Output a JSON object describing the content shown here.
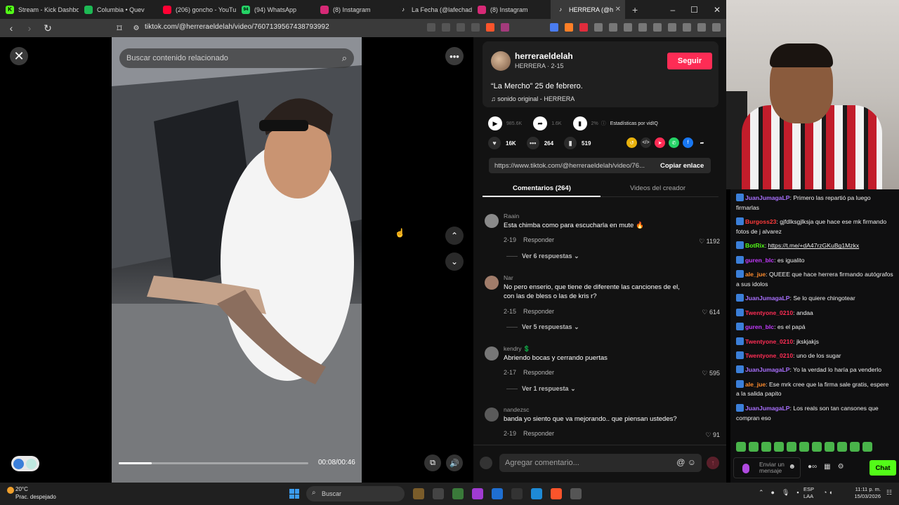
{
  "browser": {
    "tabs": [
      {
        "title": "Stream - Kick Dashbo",
        "fav_color": "#53fc18",
        "fav_char": "K"
      },
      {
        "title": "Columbia • Quev",
        "fav_color": "#1db954",
        "fav_char": ""
      },
      {
        "title": "(206) goncho - YouTu",
        "fav_color": "#ff0033",
        "fav_char": ""
      },
      {
        "title": "(94) WhatsApp",
        "fav_color": "#25d366",
        "fav_char": "94"
      },
      {
        "title": "(8) Instagram",
        "fav_color": "#d62976",
        "fav_char": ""
      },
      {
        "title": "La Fecha (@lafechade",
        "fav_color": "#ffffff",
        "fav_char": "♪"
      },
      {
        "title": "(8) Instagram",
        "fav_color": "#d62976",
        "fav_char": ""
      },
      {
        "title": "HERRERA (@h",
        "fav_color": "#ffffff",
        "fav_char": "♪",
        "active": true
      }
    ],
    "url": "tiktok.com/@herreraeldelah/video/7607139567438793992"
  },
  "video": {
    "search_placeholder": "Buscar contenido relacionado",
    "progress": 0.174,
    "time": "00:08/00:46"
  },
  "creator": {
    "handle": "herreraeldelah",
    "subtitle": "HERRERA · 2-15",
    "follow_label": "Seguir",
    "description": "“La Mercho” 25 de febrero.",
    "sound": "sonido original - HERRERA"
  },
  "stats": {
    "plays": "985.6K",
    "shares": "1.6K",
    "percent": "2%",
    "stats_label": "Estadísticas por vidIQ"
  },
  "actions": {
    "likes": "16K",
    "comments": "264",
    "saves": "519"
  },
  "link": {
    "url": "https://www.tiktok.com/@herreraeldelah/video/76...",
    "copy_label": "Copiar enlace"
  },
  "tabs": {
    "comments": "Comentarios (264)",
    "creator_videos": "Videos del creador"
  },
  "comments": [
    {
      "user": "Raain",
      "text": "Esta chimba como para escucharla en mute 🔥",
      "date": "2-19",
      "reply": "Responder",
      "likes": "1192",
      "more": "Ver 6 respuestas"
    },
    {
      "user": "Nar",
      "text": "No pero enserio, que tiene de diferente las canciones de el, con las de bless o las de kris r?",
      "date": "2-15",
      "reply": "Responder",
      "likes": "614",
      "more": "Ver 5 respuestas"
    },
    {
      "user": "kendry 💲",
      "text": "Abriendo bocas y cerrando puertas",
      "date": "2-17",
      "reply": "Responder",
      "likes": "595",
      "more": "Ver 1 respuesta"
    },
    {
      "user": "nandezsc",
      "text": "banda yo siento que va mejorando.. que piensan ustedes?",
      "date": "2-19",
      "reply": "Responder",
      "likes": "91",
      "more": ""
    }
  ],
  "comment_input": {
    "placeholder": "Agregar comentario..."
  },
  "chat": {
    "messages": [
      {
        "user": "JuanJumagaLP",
        "color": "#a970ff",
        "text": "Primero las repartió pa luego firmarlas"
      },
      {
        "user": "Burgoss23",
        "color": "#ff3b3b",
        "text": "gjfdlksgjlksja que hace ese mk firmando fotos de j alvarez"
      },
      {
        "user": "BotRix",
        "color": "#53fc18",
        "text": "https://t.me/+dA47rzGKuBg1Mzkx"
      },
      {
        "user": "guren_blc",
        "color": "#c43bff",
        "text": "es igualito"
      },
      {
        "user": "ale_jue",
        "color": "#ff8c2e",
        "text": "QUEEE que hace herrera firmando autógrafos a sus idolos"
      },
      {
        "user": "JuanJumagaLP",
        "color": "#a970ff",
        "text": "Se lo quiere chingotear"
      },
      {
        "user": "Twentyone_0210",
        "color": "#ff2d55",
        "text": "andaa"
      },
      {
        "user": "guren_blc",
        "color": "#c43bff",
        "text": "es el papá"
      },
      {
        "user": "Twentyone_0210",
        "color": "#ff2d55",
        "text": "jkskjakjs"
      },
      {
        "user": "Twentyone_0210",
        "color": "#ff2d55",
        "text": "uno de los sugar"
      },
      {
        "user": "JuanJumagaLP",
        "color": "#a970ff",
        "text": "Yo la verdad lo haría pa venderlo"
      },
      {
        "user": "ale_jue",
        "color": "#ff8c2e",
        "text": "Ese mrk cree que la firma sale gratis, espere a la salida papito"
      },
      {
        "user": "JuanJumagaLP",
        "color": "#a970ff",
        "text": "Los reals son tan cansones que compran eso"
      }
    ],
    "input_placeholder": "Enviar un mensaje",
    "chat_button": "Chat"
  },
  "taskbar": {
    "weather_temp": "20°C",
    "weather_desc": "Prac. despejado",
    "search": "Buscar",
    "lang_1": "ESP",
    "lang_2": "LAA",
    "time": "11:11 p. m.",
    "date": "15/03/2026"
  }
}
